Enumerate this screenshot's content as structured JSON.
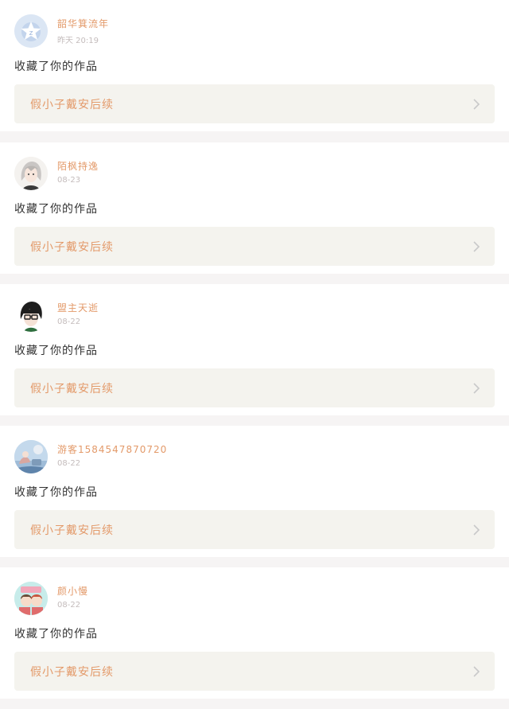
{
  "notifications": [
    {
      "user": "韶华箕流年",
      "time": "昨天 20:19",
      "action": "收藏了你的作品",
      "work_title": "假小子戴安后续",
      "avatar_icon": "star-badge-avatar"
    },
    {
      "user": "陌枫持逸",
      "time": "08-23",
      "action": "收藏了你的作品",
      "work_title": "假小子戴安后续",
      "avatar_icon": "anime-silver-hair-avatar"
    },
    {
      "user": "盟主天逝",
      "time": "08-22",
      "action": "收藏了你的作品",
      "work_title": "假小子戴安后续",
      "avatar_icon": "anime-glasses-avatar"
    },
    {
      "user": "游客1584547870720",
      "time": "08-22",
      "action": "收藏了你的作品",
      "work_title": "假小子戴安后续",
      "avatar_icon": "illustrated-scene-avatar"
    },
    {
      "user": "颜小慢",
      "time": "08-22",
      "action": "收藏了你的作品",
      "work_title": "假小子戴安后续",
      "avatar_icon": "cartoon-couple-avatar"
    }
  ],
  "colors": {
    "accent": "#e39a6a",
    "indicator": "#e66b9a",
    "link_bg": "#f4f3ee",
    "time": "#c4bcbc",
    "page_bg": "#f6f4f4"
  }
}
